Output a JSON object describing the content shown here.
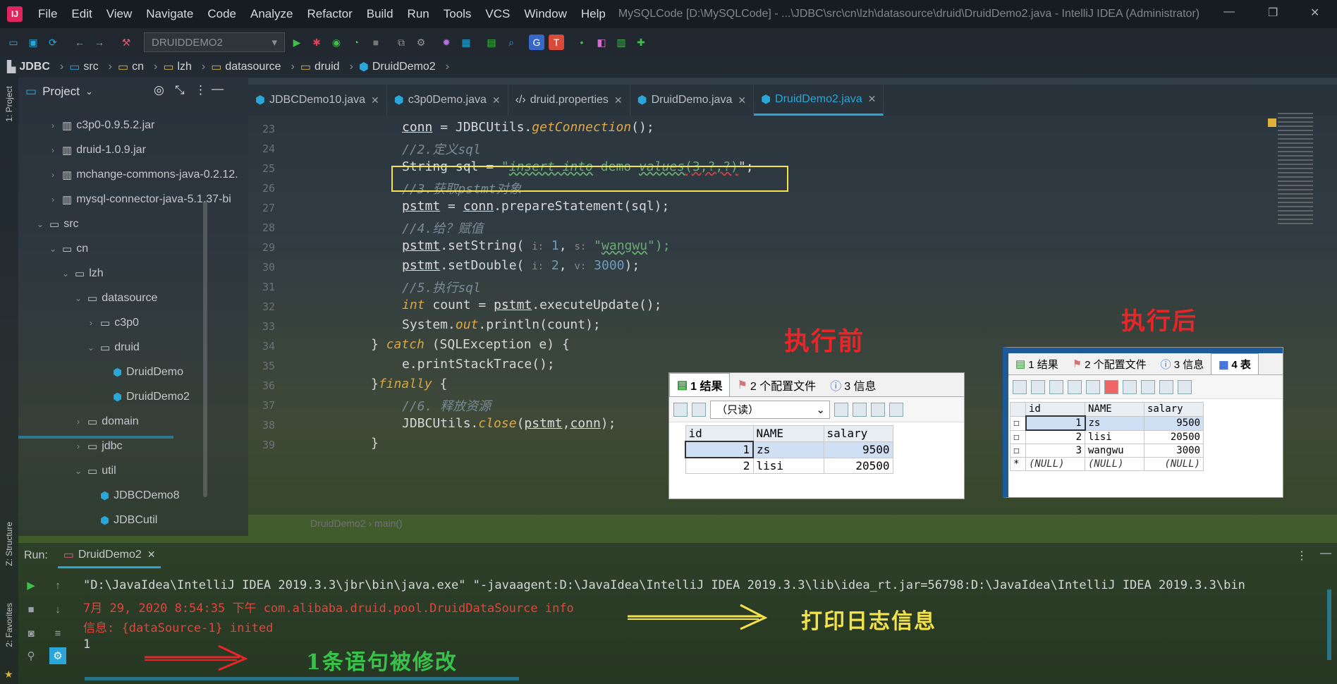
{
  "app": {
    "menu": [
      "File",
      "Edit",
      "View",
      "Navigate",
      "Code",
      "Analyze",
      "Refactor",
      "Build",
      "Run",
      "Tools",
      "VCS",
      "Window",
      "Help"
    ],
    "window_title": "MySQLCode [D:\\MySQLCode] - ...\\JDBC\\src\\cn\\lzh\\datasource\\druid\\DruidDemo2.java - IntelliJ IDEA (Administrator)"
  },
  "toolbar": {
    "run_config": "DRUIDDEMO2"
  },
  "breadcrumb": [
    "JDBC",
    "src",
    "cn",
    "lzh",
    "datasource",
    "druid",
    "DruidDemo2"
  ],
  "left_strip": {
    "project_label": "1: Project",
    "structure_label": "Z: Structure",
    "favorites_label": "2: Favorites"
  },
  "project": {
    "title": "Project",
    "tree": [
      {
        "label": "c3p0-0.9.5.2.jar",
        "indent": 1,
        "arrow": "›",
        "icon": "jar"
      },
      {
        "label": "druid-1.0.9.jar",
        "indent": 1,
        "arrow": "›",
        "icon": "jar"
      },
      {
        "label": "mchange-commons-java-0.2.12.",
        "indent": 1,
        "arrow": "›",
        "icon": "jar"
      },
      {
        "label": "mysql-connector-java-5.1.37-bi",
        "indent": 1,
        "arrow": "›",
        "icon": "jar"
      },
      {
        "label": "src",
        "indent": 0,
        "arrow": "⌄",
        "icon": "folder"
      },
      {
        "label": "cn",
        "indent": 1,
        "arrow": "⌄",
        "icon": "folder"
      },
      {
        "label": "lzh",
        "indent": 2,
        "arrow": "⌄",
        "icon": "folder"
      },
      {
        "label": "datasource",
        "indent": 3,
        "arrow": "⌄",
        "icon": "folder"
      },
      {
        "label": "c3p0",
        "indent": 4,
        "arrow": "›",
        "icon": "folder"
      },
      {
        "label": "druid",
        "indent": 4,
        "arrow": "⌄",
        "icon": "folder"
      },
      {
        "label": "DruidDemo",
        "indent": 5,
        "arrow": "",
        "icon": "cls"
      },
      {
        "label": "DruidDemo2",
        "indent": 5,
        "arrow": "",
        "icon": "cls"
      },
      {
        "label": "domain",
        "indent": 3,
        "arrow": "›",
        "icon": "folder"
      },
      {
        "label": "jdbc",
        "indent": 3,
        "arrow": "›",
        "icon": "folder"
      },
      {
        "label": "util",
        "indent": 3,
        "arrow": "⌄",
        "icon": "folder"
      },
      {
        "label": "JDBCDemo8",
        "indent": 4,
        "arrow": "",
        "icon": "cls"
      },
      {
        "label": "JDBCutil",
        "indent": 4,
        "arrow": "",
        "icon": "cls"
      }
    ]
  },
  "tabs": [
    {
      "label": "JDBCDemo10.java",
      "active": false
    },
    {
      "label": "c3p0Demo.java",
      "active": false
    },
    {
      "label": "druid.properties",
      "active": false
    },
    {
      "label": "DruidDemo.java",
      "active": false
    },
    {
      "label": "DruidDemo2.java",
      "active": true
    }
  ],
  "editor": {
    "line_numbers": [
      "23",
      "24",
      "25",
      "26",
      "27",
      "28",
      "29",
      "30",
      "31",
      "32",
      "33",
      "34",
      "35",
      "36",
      "37",
      "38",
      "39"
    ],
    "crumb": "DruidDemo2  ›  main()",
    "c1": "conn",
    "c2": " = ",
    "c3": "JDBCUtils",
    "c4": ".",
    "c5": "getConnection",
    "c6": "();",
    "c7": "//2.定义sql",
    "c8": "String sql = ",
    "c9": "\"",
    "c10": "insert into",
    "c11": " demo ",
    "c12": "values",
    "c13": "(3,?,?)",
    "c14": "\";",
    "c15": "//3.获取pstmt对象",
    "c16": "pstmt",
    "c17": " = ",
    "c18": "conn",
    "c19": ".prepareStatement(sql);",
    "c20": "//4.给？赋值",
    "c21": "pstmt",
    "c22": ".setString( ",
    "c23": "i:",
    "c24": " 1",
    "c25": ", ",
    "c26": "s:",
    "c27": " \"",
    "c28": "wangwu",
    "c29": "\");",
    "c30": "pstmt",
    "c31": ".setDouble( ",
    "c32": "i:",
    "c33": " 2",
    "c34": ", ",
    "c35": "v:",
    "c36": " 3000",
    "c37": ");",
    "c38": "//5.执行sql",
    "c39": "int",
    "c40": " count = ",
    "c41": "pstmt",
    "c42": ".executeUpdate();",
    "c43": "System.",
    "c44": "out",
    "c45": ".println(count);",
    "c46": "} ",
    "c47": "catch",
    "c48": " (SQLException e) {",
    "c49": "e.printStackTrace();",
    "c50": "}",
    "c51": "finally",
    "c52": " {",
    "c53": "//6. 释放资源",
    "c54": "JDBCUtils.",
    "c55": "close",
    "c56": "(",
    "c57": "pstmt",
    "c58": ",",
    "c59": "conn",
    "c60": ");",
    "c61": "}"
  },
  "annotations": {
    "before": "执行前",
    "after": "执行后",
    "log": "打印日志信息",
    "modified": "1条语句被修改"
  },
  "db_before": {
    "tabs": [
      "1 结果",
      "2 个配置文件",
      "3 信息"
    ],
    "readonly": "（只读）",
    "headers": [
      "id",
      "NAME",
      "salary"
    ],
    "rows": [
      [
        "1",
        "zs",
        "9500"
      ],
      [
        "2",
        "lisi",
        "20500"
      ]
    ]
  },
  "db_after": {
    "tabs": [
      "1 结果",
      "2 个配置文件",
      "3 信息",
      "4 表"
    ],
    "headers": [
      "id",
      "NAME",
      "salary"
    ],
    "rows": [
      [
        "1",
        "zs",
        "9500"
      ],
      [
        "2",
        "lisi",
        "20500"
      ],
      [
        "3",
        "wangwu",
        "3000"
      ]
    ],
    "null_row": [
      "*",
      "(NULL)",
      "(NULL)",
      "(NULL)"
    ]
  },
  "run": {
    "label": "Run:",
    "tab": "DruidDemo2",
    "lines": [
      "\"D:\\JavaIdea\\IntelliJ IDEA 2019.3.3\\jbr\\bin\\java.exe\" \"-javaagent:D:\\JavaIdea\\IntelliJ IDEA 2019.3.3\\lib\\idea_rt.jar=56798:D:\\JavaIdea\\IntelliJ IDEA 2019.3.3\\bin",
      "7月 29, 2020 8:54:35 下午 com.alibaba.druid.pool.DruidDataSource info",
      "信息: {dataSource-1} inited",
      "1"
    ]
  },
  "colors": {
    "accent": "#2aa7d8",
    "annotation_red": "#e8262a",
    "annotation_yellow": "#f3e24a",
    "annotation_green": "#39c24a"
  }
}
